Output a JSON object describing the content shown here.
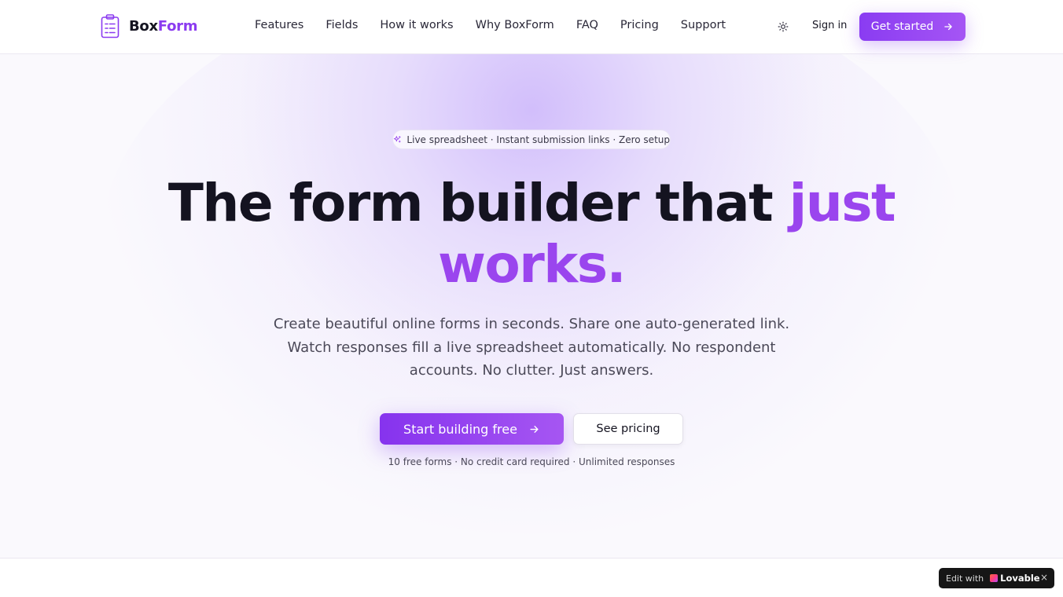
{
  "brand": {
    "name_part1": "Box",
    "name_part2": "Form",
    "icon": "clipboard-list-icon"
  },
  "nav": {
    "items": [
      {
        "label": "Features"
      },
      {
        "label": "Fields"
      },
      {
        "label": "How it works"
      },
      {
        "label": "Why BoxForm"
      },
      {
        "label": "FAQ"
      },
      {
        "label": "Pricing"
      },
      {
        "label": "Support"
      }
    ],
    "theme_icon": "sun-icon",
    "signin_label": "Sign in",
    "cta_label": "Get started"
  },
  "hero": {
    "badge_icon": "sparkles-icon",
    "badge_text": "Live spreadsheet · Instant submission links · Zero setup",
    "title_part1": "The form builder that",
    "title_accent1": "just",
    "title_accent2": "works.",
    "subtitle": "Create beautiful online forms in seconds. Share one auto-generated link. Watch responses fill a live spreadsheet automatically. No respondent accounts. No clutter. Just answers.",
    "primary_cta": "Start building free",
    "secondary_cta": "See pricing",
    "fineprint": "10 free forms · No credit card required · Unlimited responses"
  },
  "lovable_badge": {
    "prefix": "Edit with",
    "brand": "Lovable",
    "close": "×"
  },
  "colors": {
    "accent": "#8b3bf0",
    "accent_light": "#a555f4",
    "text": "#141320",
    "muted": "#4b4958"
  }
}
